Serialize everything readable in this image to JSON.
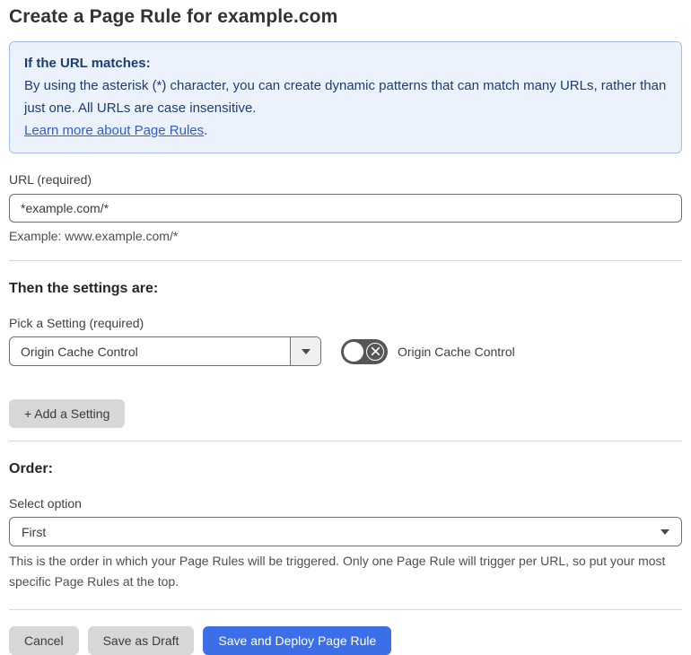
{
  "page": {
    "title": "Create a Page Rule for example.com"
  },
  "info_box": {
    "heading": "If the URL matches:",
    "body": "By using the asterisk (*) character, you can create dynamic patterns that can match many URLs, rather than just one. All URLs are case insensitive.",
    "link_label": "Learn more about Page Rules",
    "link_suffix": "."
  },
  "url_field": {
    "label": "URL (required)",
    "value": "*example.com/*",
    "hint": "Example: www.example.com/*"
  },
  "settings_section": {
    "heading": "Then the settings are:",
    "picker_label": "Pick a Setting (required)",
    "picker_value": "Origin Cache Control",
    "toggle_label": "Origin Cache Control",
    "toggle_state": "off",
    "add_setting_label": "+ Add a Setting"
  },
  "order_section": {
    "heading": "Order:",
    "select_label": "Select option",
    "select_value": "First",
    "help_text": "This is the order in which your Page Rules will be triggered. Only one Page Rule will trigger per URL, so put your most specific Page Rules at the top."
  },
  "footer": {
    "cancel_label": "Cancel",
    "save_draft_label": "Save as Draft",
    "save_deploy_label": "Save and Deploy Page Rule"
  },
  "colors": {
    "accent_blue": "#3C6FE7",
    "button_gray": "#D7D7D7",
    "info_bg": "#EBF2FC",
    "info_border": "#9EC1EE",
    "info_text": "#1E3D6F",
    "link_blue": "#2E5DD1",
    "toggle_off_track": "#565656"
  }
}
